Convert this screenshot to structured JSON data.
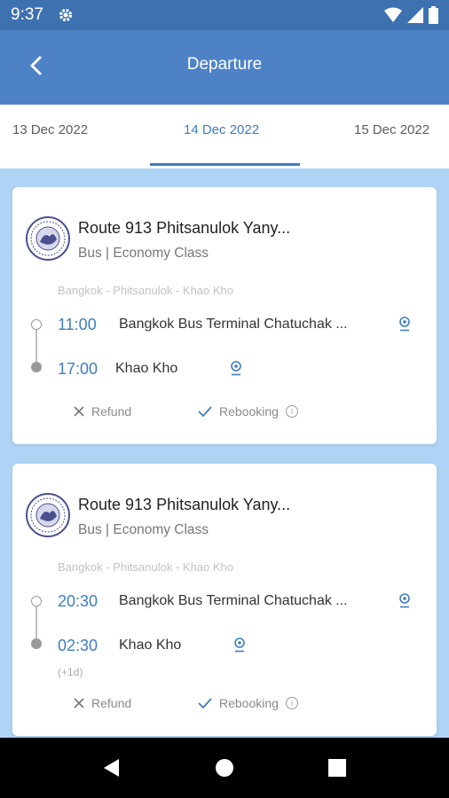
{
  "status_bar": {
    "time": "9:37",
    "icons": [
      "gear-icon",
      "wifi-icon",
      "signal-icon",
      "battery-icon"
    ]
  },
  "header": {
    "title": "Departure",
    "back_icon": "chevron-left-icon"
  },
  "date_tabs": [
    {
      "label": "13 Dec 2022",
      "active": false
    },
    {
      "label": "14 Dec 2022",
      "active": true
    },
    {
      "label": "15 Dec 2022",
      "active": false
    }
  ],
  "trips": [
    {
      "route_name": "Route 913 Phitsanulok Yany...",
      "vehicle": "Bus",
      "separator": "|",
      "class": "Economy Class",
      "route_path": "Bangkok - Phitsanulok - Khao Kho",
      "departure_time": "11:00",
      "departure_station": "Bangkok Bus Terminal Chatuchak ...",
      "arrival_time": "17:00",
      "arrival_station": "Khao Kho",
      "arrival_note": "",
      "refund_label": "Refund",
      "rebooking_label": "Rebooking"
    },
    {
      "route_name": "Route 913 Phitsanulok Yany...",
      "vehicle": "Bus",
      "separator": "|",
      "class": "Economy Class",
      "route_path": "Bangkok - Phitsanulok - Khao Kho",
      "departure_time": "20:30",
      "departure_station": "Bangkok Bus Terminal Chatuchak ...",
      "arrival_time": "02:30",
      "arrival_station": "Khao Kho",
      "arrival_note": "(+1d)",
      "refund_label": "Refund",
      "rebooking_label": "Rebooking"
    }
  ],
  "colors": {
    "status_bar": "#3e71b0",
    "app_bar": "#4d82c6",
    "accent": "#3e7dc2",
    "background": "#aed3f5"
  }
}
